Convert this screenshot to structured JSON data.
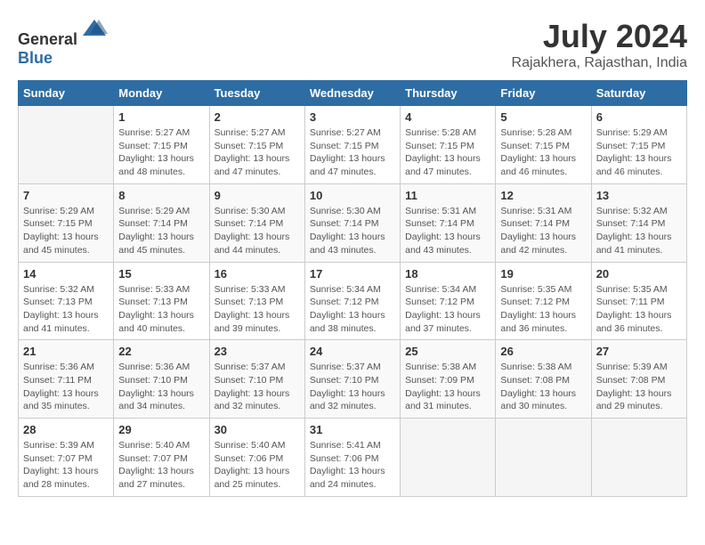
{
  "logo": {
    "text_general": "General",
    "text_blue": "Blue"
  },
  "title": "July 2024",
  "subtitle": "Rajakhera, Rajasthan, India",
  "headers": [
    "Sunday",
    "Monday",
    "Tuesday",
    "Wednesday",
    "Thursday",
    "Friday",
    "Saturday"
  ],
  "weeks": [
    [
      {
        "day": "",
        "info": ""
      },
      {
        "day": "1",
        "info": "Sunrise: 5:27 AM\nSunset: 7:15 PM\nDaylight: 13 hours\nand 48 minutes."
      },
      {
        "day": "2",
        "info": "Sunrise: 5:27 AM\nSunset: 7:15 PM\nDaylight: 13 hours\nand 47 minutes."
      },
      {
        "day": "3",
        "info": "Sunrise: 5:27 AM\nSunset: 7:15 PM\nDaylight: 13 hours\nand 47 minutes."
      },
      {
        "day": "4",
        "info": "Sunrise: 5:28 AM\nSunset: 7:15 PM\nDaylight: 13 hours\nand 47 minutes."
      },
      {
        "day": "5",
        "info": "Sunrise: 5:28 AM\nSunset: 7:15 PM\nDaylight: 13 hours\nand 46 minutes."
      },
      {
        "day": "6",
        "info": "Sunrise: 5:29 AM\nSunset: 7:15 PM\nDaylight: 13 hours\nand 46 minutes."
      }
    ],
    [
      {
        "day": "7",
        "info": "Sunrise: 5:29 AM\nSunset: 7:15 PM\nDaylight: 13 hours\nand 45 minutes."
      },
      {
        "day": "8",
        "info": "Sunrise: 5:29 AM\nSunset: 7:14 PM\nDaylight: 13 hours\nand 45 minutes."
      },
      {
        "day": "9",
        "info": "Sunrise: 5:30 AM\nSunset: 7:14 PM\nDaylight: 13 hours\nand 44 minutes."
      },
      {
        "day": "10",
        "info": "Sunrise: 5:30 AM\nSunset: 7:14 PM\nDaylight: 13 hours\nand 43 minutes."
      },
      {
        "day": "11",
        "info": "Sunrise: 5:31 AM\nSunset: 7:14 PM\nDaylight: 13 hours\nand 43 minutes."
      },
      {
        "day": "12",
        "info": "Sunrise: 5:31 AM\nSunset: 7:14 PM\nDaylight: 13 hours\nand 42 minutes."
      },
      {
        "day": "13",
        "info": "Sunrise: 5:32 AM\nSunset: 7:14 PM\nDaylight: 13 hours\nand 41 minutes."
      }
    ],
    [
      {
        "day": "14",
        "info": "Sunrise: 5:32 AM\nSunset: 7:13 PM\nDaylight: 13 hours\nand 41 minutes."
      },
      {
        "day": "15",
        "info": "Sunrise: 5:33 AM\nSunset: 7:13 PM\nDaylight: 13 hours\nand 40 minutes."
      },
      {
        "day": "16",
        "info": "Sunrise: 5:33 AM\nSunset: 7:13 PM\nDaylight: 13 hours\nand 39 minutes."
      },
      {
        "day": "17",
        "info": "Sunrise: 5:34 AM\nSunset: 7:12 PM\nDaylight: 13 hours\nand 38 minutes."
      },
      {
        "day": "18",
        "info": "Sunrise: 5:34 AM\nSunset: 7:12 PM\nDaylight: 13 hours\nand 37 minutes."
      },
      {
        "day": "19",
        "info": "Sunrise: 5:35 AM\nSunset: 7:12 PM\nDaylight: 13 hours\nand 36 minutes."
      },
      {
        "day": "20",
        "info": "Sunrise: 5:35 AM\nSunset: 7:11 PM\nDaylight: 13 hours\nand 36 minutes."
      }
    ],
    [
      {
        "day": "21",
        "info": "Sunrise: 5:36 AM\nSunset: 7:11 PM\nDaylight: 13 hours\nand 35 minutes."
      },
      {
        "day": "22",
        "info": "Sunrise: 5:36 AM\nSunset: 7:10 PM\nDaylight: 13 hours\nand 34 minutes."
      },
      {
        "day": "23",
        "info": "Sunrise: 5:37 AM\nSunset: 7:10 PM\nDaylight: 13 hours\nand 32 minutes."
      },
      {
        "day": "24",
        "info": "Sunrise: 5:37 AM\nSunset: 7:10 PM\nDaylight: 13 hours\nand 32 minutes."
      },
      {
        "day": "25",
        "info": "Sunrise: 5:38 AM\nSunset: 7:09 PM\nDaylight: 13 hours\nand 31 minutes."
      },
      {
        "day": "26",
        "info": "Sunrise: 5:38 AM\nSunset: 7:08 PM\nDaylight: 13 hours\nand 30 minutes."
      },
      {
        "day": "27",
        "info": "Sunrise: 5:39 AM\nSunset: 7:08 PM\nDaylight: 13 hours\nand 29 minutes."
      }
    ],
    [
      {
        "day": "28",
        "info": "Sunrise: 5:39 AM\nSunset: 7:07 PM\nDaylight: 13 hours\nand 28 minutes."
      },
      {
        "day": "29",
        "info": "Sunrise: 5:40 AM\nSunset: 7:07 PM\nDaylight: 13 hours\nand 27 minutes."
      },
      {
        "day": "30",
        "info": "Sunrise: 5:40 AM\nSunset: 7:06 PM\nDaylight: 13 hours\nand 25 minutes."
      },
      {
        "day": "31",
        "info": "Sunrise: 5:41 AM\nSunset: 7:06 PM\nDaylight: 13 hours\nand 24 minutes."
      },
      {
        "day": "",
        "info": ""
      },
      {
        "day": "",
        "info": ""
      },
      {
        "day": "",
        "info": ""
      }
    ]
  ]
}
